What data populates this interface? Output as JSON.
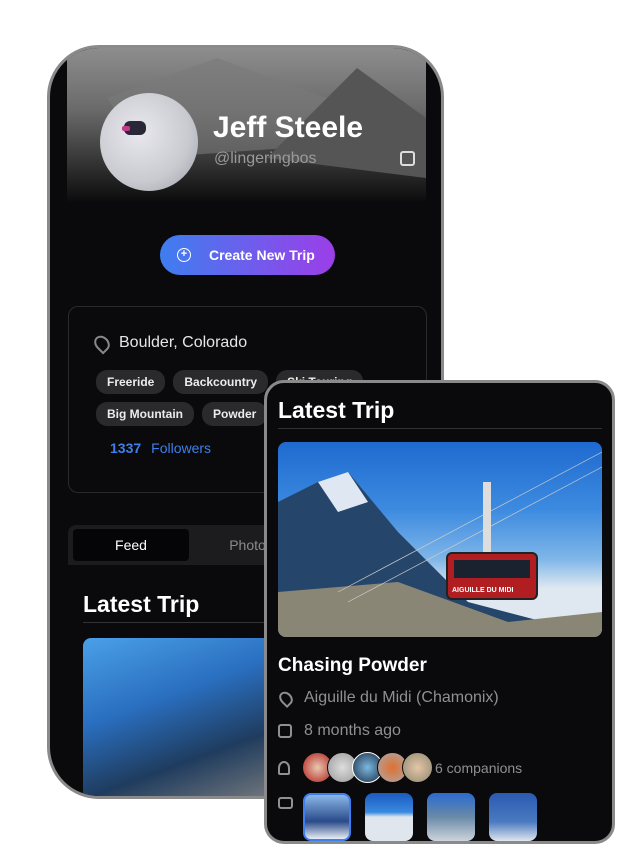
{
  "profile": {
    "name": "Jeff Steele",
    "handle": "@lingeringbos",
    "edit_icon": "edit-icon"
  },
  "create_button": {
    "label": "Create New Trip",
    "icon": "plus-circle-icon"
  },
  "info": {
    "location": "Boulder, Colorado",
    "tags": [
      "Freeride",
      "Backcountry",
      "Ski Touring",
      "Big Mountain",
      "Powder"
    ],
    "followers_count": "1337",
    "followers_label": "Followers"
  },
  "tabs": [
    {
      "label": "Feed",
      "active": true
    },
    {
      "label": "Photos",
      "active": false
    }
  ],
  "latest_trip": {
    "heading": "Latest Trip",
    "title": "Chasing Powder",
    "location": "Aiguille du Midi (Chamonix)",
    "time": "8 months ago",
    "companions": "6 companions",
    "gondola_sign": "AIGUILLE DU MIDI"
  },
  "colors": {
    "accent": "#3f7fe8",
    "gradient_start": "#3e7ef0",
    "gradient_end": "#9c3ee8",
    "background": "#0a0a0c"
  }
}
